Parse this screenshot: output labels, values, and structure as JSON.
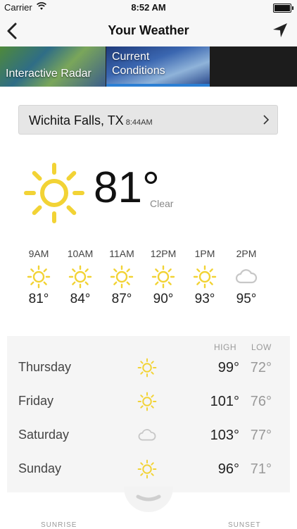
{
  "status_bar": {
    "carrier": "Carrier",
    "time": "8:52 AM"
  },
  "nav": {
    "title": "Your Weather"
  },
  "tabs": [
    {
      "label": "Interactive Radar"
    },
    {
      "label_line1": "Current",
      "label_line2": "Conditions",
      "selected": true
    }
  ],
  "location": {
    "city": "Wichita Falls, TX",
    "local_time": "8:44AM"
  },
  "current": {
    "temperature": "81°",
    "condition": "Clear",
    "icon": "sun-icon"
  },
  "hourly": [
    {
      "time": "9AM",
      "icon": "sun-icon",
      "temp": "81°"
    },
    {
      "time": "10AM",
      "icon": "sun-icon",
      "temp": "84°"
    },
    {
      "time": "11AM",
      "icon": "sun-icon",
      "temp": "87°"
    },
    {
      "time": "12PM",
      "icon": "sun-icon",
      "temp": "90°"
    },
    {
      "time": "1PM",
      "icon": "sun-icon",
      "temp": "93°"
    },
    {
      "time": "2PM",
      "icon": "cloud-icon",
      "temp": "95°"
    }
  ],
  "daily": {
    "high_label": "HIGH",
    "low_label": "LOW",
    "days": [
      {
        "name": "Thursday",
        "icon": "sun-icon",
        "high": "99°",
        "low": "72°"
      },
      {
        "name": "Friday",
        "icon": "sun-icon",
        "high": "101°",
        "low": "76°"
      },
      {
        "name": "Saturday",
        "icon": "cloud-icon",
        "high": "103°",
        "low": "77°"
      },
      {
        "name": "Sunday",
        "icon": "sun-icon",
        "high": "96°",
        "low": "71°"
      }
    ]
  },
  "sun_times": {
    "sunrise_label": "SUNRISE",
    "sunset_label": "SUNSET"
  },
  "colors": {
    "accent": "#2b7fd4",
    "sun": "#f2d335",
    "cloud": "#c7c7c7"
  }
}
